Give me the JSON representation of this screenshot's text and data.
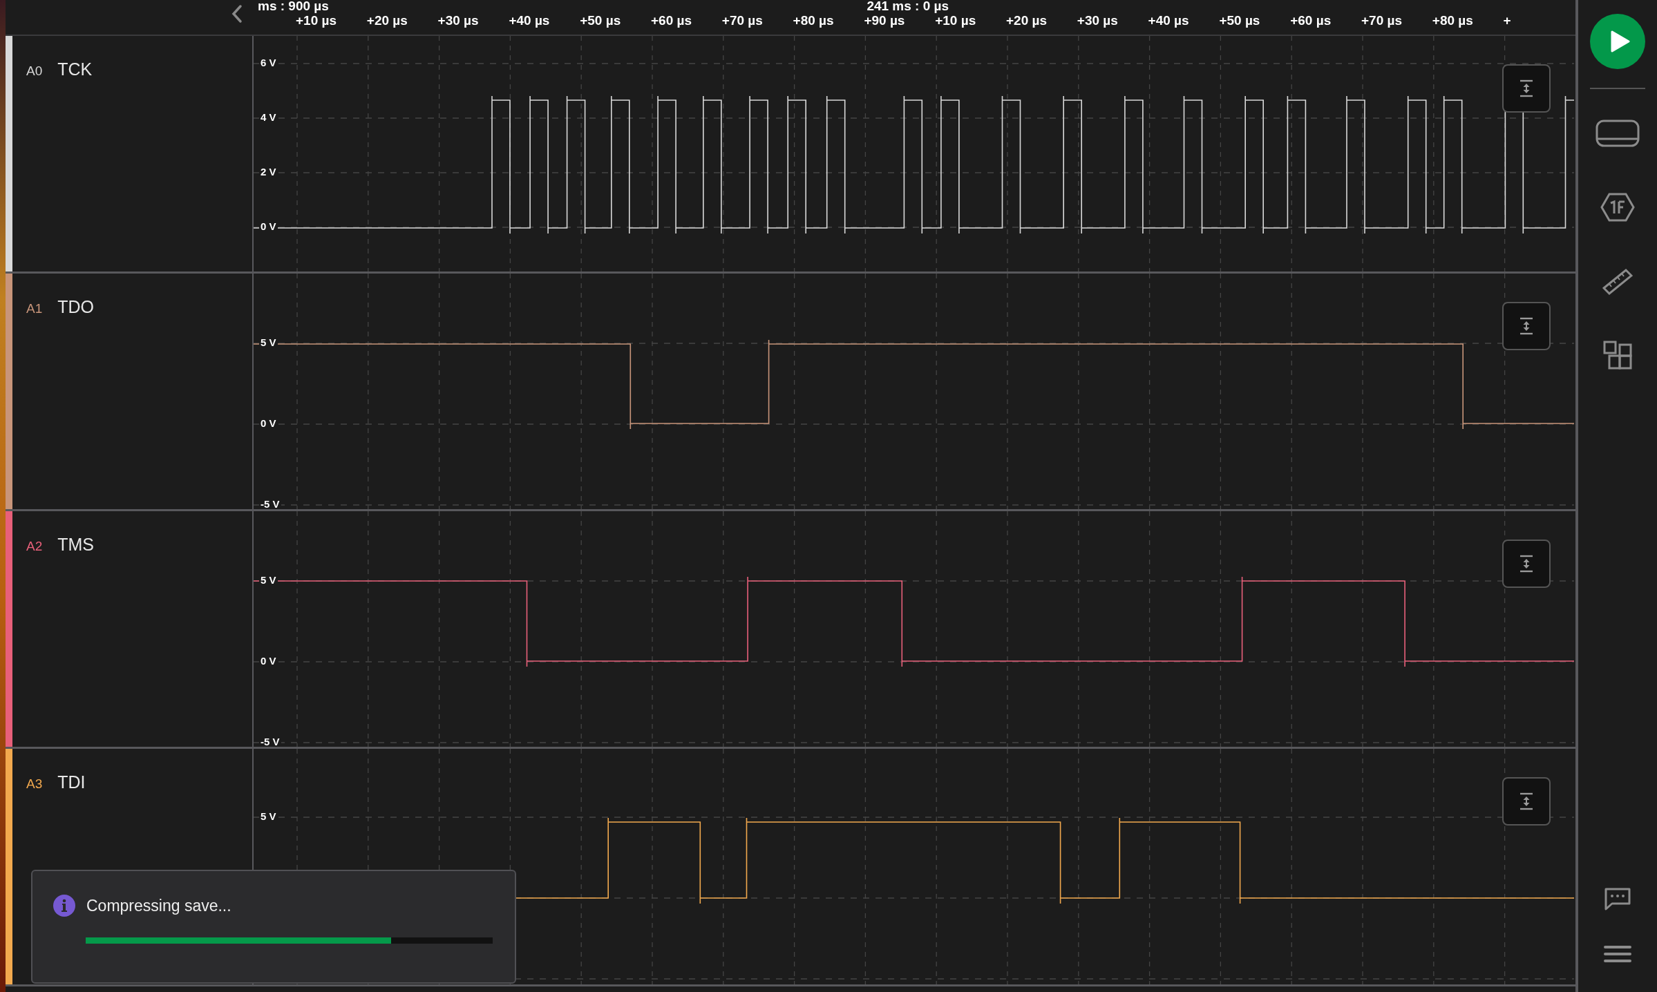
{
  "time_axis": [
    {
      "origin": "ms : 900 µs",
      "ticks": [
        "+10 µs",
        "+20 µs",
        "+30 µs",
        "+40 µs",
        "+50 µs",
        "+60 µs",
        "+70 µs",
        "+80 µs",
        "+90 µs"
      ]
    },
    {
      "origin": "241 ms : 0 µs",
      "ticks": [
        "+10 µs",
        "+20 µs",
        "+30 µs",
        "+40 µs",
        "+50 µs",
        "+60 µs",
        "+70 µs",
        "+80 µs",
        "+"
      ]
    }
  ],
  "channels": [
    {
      "id": "A0",
      "name": "TCK",
      "color": "#d9d9d9",
      "y_labels": [
        "6 V",
        "4 V",
        "2 V",
        "0 V"
      ]
    },
    {
      "id": "A1",
      "name": "TDO",
      "color": "#c8957a",
      "y_labels": [
        "5 V",
        "0 V",
        "-5 V"
      ]
    },
    {
      "id": "A2",
      "name": "TMS",
      "color": "#e8607a",
      "y_labels": [
        "5 V",
        "0 V",
        "-5 V"
      ]
    },
    {
      "id": "A3",
      "name": "TDI",
      "color": "#f2a94e",
      "y_labels": [
        "5 V"
      ]
    }
  ],
  "toast": {
    "message": "Compressing save...",
    "level": 0.75
  }
}
